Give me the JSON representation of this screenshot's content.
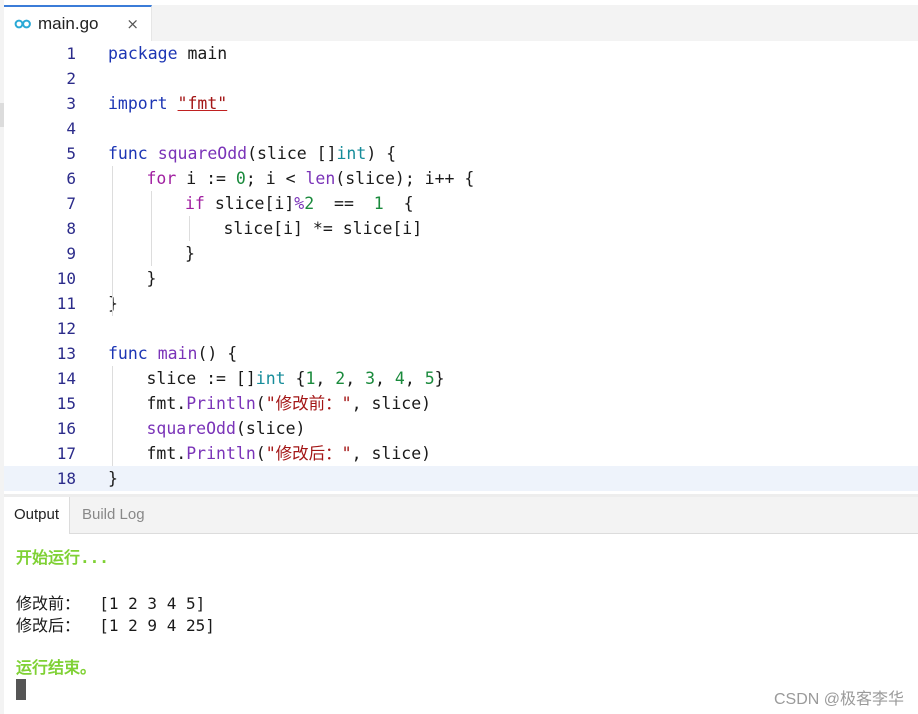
{
  "editor_tab": {
    "icon": "go-icon",
    "label": "main.go",
    "close": "×"
  },
  "code_lines": [
    {
      "n": "1"
    },
    {
      "n": "2"
    },
    {
      "n": "3"
    },
    {
      "n": "4"
    },
    {
      "n": "5"
    },
    {
      "n": "6"
    },
    {
      "n": "7"
    },
    {
      "n": "8"
    },
    {
      "n": "9"
    },
    {
      "n": "10"
    },
    {
      "n": "11"
    },
    {
      "n": "12"
    },
    {
      "n": "13"
    },
    {
      "n": "14"
    },
    {
      "n": "15"
    },
    {
      "n": "16"
    },
    {
      "n": "17"
    },
    {
      "n": "18"
    }
  ],
  "code_tokens": [
    [
      [
        "kw",
        "package"
      ],
      [
        "",
        "main"
      ]
    ],
    [],
    [
      [
        "kw",
        "import"
      ],
      [
        "",
        ""
      ],
      [
        "str u",
        "\"fmt\""
      ]
    ],
    [],
    [
      [
        "kw",
        "func"
      ],
      [
        "fn",
        "squareOdd"
      ],
      [
        "",
        "(slice []"
      ],
      [
        "ty",
        "int"
      ],
      [
        "",
        ") {"
      ]
    ],
    [
      [
        "",
        ""
      ],
      [
        "kw2",
        "for"
      ],
      [
        "",
        "i := "
      ],
      [
        "num",
        "0"
      ],
      [
        "",
        "; i < "
      ],
      [
        "fn",
        "len"
      ],
      [
        "",
        "(slice); i++ {"
      ]
    ],
    [
      [
        "",
        ""
      ],
      [
        "kw2",
        "if"
      ],
      [
        "",
        "slice[i]"
      ],
      [
        "op",
        "%"
      ],
      [
        "num",
        "2"
      ],
      [
        "",
        "=="
      ],
      [
        "num",
        "1"
      ],
      [
        "",
        "{"
      ]
    ],
    [
      [
        "",
        ""
      ],
      [
        "",
        "slice[i] *= slice[i]"
      ]
    ],
    [
      [
        "",
        "}"
      ]
    ],
    [
      [
        "",
        "}"
      ]
    ],
    [
      [
        "",
        "}"
      ]
    ],
    [],
    [
      [
        "kw",
        "func"
      ],
      [
        "fn",
        "main"
      ],
      [
        "",
        "() {"
      ]
    ],
    [
      [
        "",
        "slice := []"
      ],
      [
        "ty",
        "int"
      ],
      [
        "",
        "{"
      ],
      [
        "num",
        "1"
      ],
      [
        "",
        ", "
      ],
      [
        "num",
        "2"
      ],
      [
        "",
        ", "
      ],
      [
        "num",
        "3"
      ],
      [
        "",
        ", "
      ],
      [
        "num",
        "4"
      ],
      [
        "",
        ", "
      ],
      [
        "num",
        "5"
      ],
      [
        "",
        "}"
      ]
    ],
    [
      [
        "",
        "fmt."
      ],
      [
        "fn",
        "Println"
      ],
      [
        "",
        "("
      ],
      [
        "str",
        "\"修改前：\""
      ],
      [
        "",
        ", slice)"
      ]
    ],
    [
      [
        "fn",
        "squareOdd"
      ],
      [
        "",
        "(slice)"
      ]
    ],
    [
      [
        "",
        "fmt."
      ],
      [
        "fn",
        "Println"
      ],
      [
        "",
        "("
      ],
      [
        "str",
        "\"修改后：\""
      ],
      [
        "",
        ", slice)"
      ]
    ],
    [
      [
        "",
        "}"
      ]
    ]
  ],
  "code_indent": [
    0,
    0,
    0,
    0,
    0,
    1,
    2,
    3,
    2,
    1,
    0,
    0,
    0,
    1,
    1,
    1,
    1,
    0
  ],
  "panel_tabs": {
    "output": "Output",
    "build_log": "Build Log"
  },
  "output": {
    "start": "开始运行...",
    "before": "修改前：  [1 2 3 4 5]",
    "after": "修改后：  [1 2 9 4 25]",
    "end": "运行结束。"
  },
  "watermark": "CSDN @极客李华",
  "colors": {
    "accent": "#3b7cd8",
    "success_green": "#7fd134",
    "keyword_blue": "#1c35b4",
    "string_red": "#a31515"
  }
}
